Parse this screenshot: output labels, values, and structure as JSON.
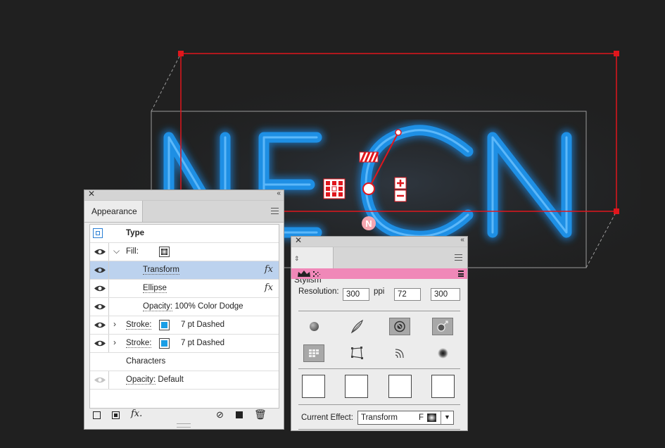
{
  "canvas": {
    "art_text": "NEON",
    "badge_letter": "N",
    "colors": {
      "background": "#202020",
      "neon": "#1f8fe0",
      "selection": "#e0161c",
      "panel": "#ececec",
      "accent_pink": "#f088b8"
    }
  },
  "appearance": {
    "tab_label": "Appearance",
    "title": "Type",
    "rows": [
      {
        "label": "Fill:",
        "value": "",
        "eye": true,
        "expanded": true
      },
      {
        "label": "Transform",
        "value": "",
        "eye": true,
        "fx": "fx",
        "selected": true
      },
      {
        "label": "Ellipse",
        "value": "",
        "eye": true,
        "fx": "fx"
      },
      {
        "label": "Opacity:",
        "value": "100% Color Dodge",
        "eye": true
      },
      {
        "label": "Stroke:",
        "value": "7 pt Dashed",
        "eye": true
      },
      {
        "label": "Stroke:",
        "value": "7 pt Dashed",
        "eye": true
      },
      {
        "label": "Characters",
        "value": "",
        "eye": false
      },
      {
        "label": "Opacity:",
        "value": "Default",
        "eye": "dim"
      }
    ],
    "footer_fx": "fx."
  },
  "stylism": {
    "tab_label": "Stylism",
    "resolution_label": "Resolution:",
    "resolution_value": "300",
    "unit": "ppi",
    "field2": "72",
    "field3": "300",
    "current_effect_label": "Current Effect:",
    "current_effect_value": "Transform",
    "effect_key": "F",
    "tools": [
      "sphere-tool",
      "feather-tool",
      "target-tool",
      "gender-tool",
      "grid-tool",
      "distort-tool",
      "waves-tool",
      "blur-tool"
    ]
  }
}
